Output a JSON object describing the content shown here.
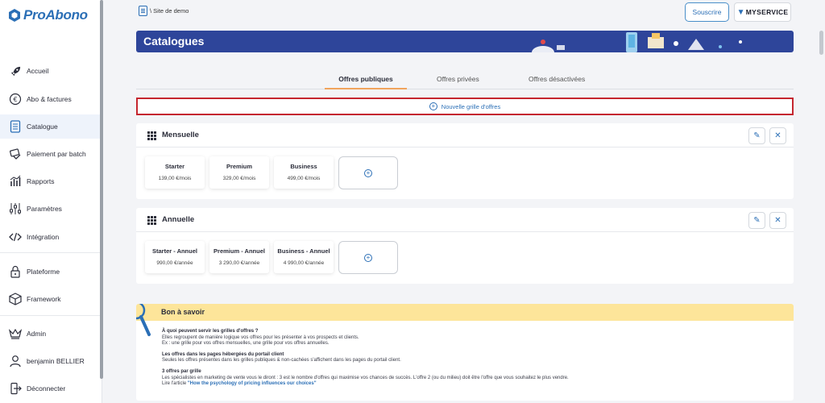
{
  "app": {
    "name": "ProAbono"
  },
  "sidebar": {
    "items": [
      {
        "label": "Accueil",
        "icon": "rocket-icon"
      },
      {
        "label": "Abo & factures",
        "icon": "euro-icon"
      },
      {
        "label": "Catalogue",
        "icon": "catalog-icon",
        "active": true
      },
      {
        "label": "Paiement par batch",
        "icon": "batch-payment-icon"
      },
      {
        "label": "Rapports",
        "icon": "reports-icon"
      },
      {
        "label": "Paramètres",
        "icon": "settings-sliders-icon"
      },
      {
        "label": "Intégration",
        "icon": "code-icon"
      },
      {
        "label": "Plateforme",
        "icon": "lock-icon"
      },
      {
        "label": "Framework",
        "icon": "cube-icon"
      },
      {
        "label": "Admin",
        "icon": "crown-icon"
      },
      {
        "label": "benjamin BELLIER",
        "icon": "user-icon"
      },
      {
        "label": "Déconnecter",
        "icon": "logout-icon"
      }
    ]
  },
  "header": {
    "breadcrumb": "\\ Site de demo",
    "subscribe_label": "Souscrire",
    "brand_badge": "MYSERVICE",
    "page_title": "Catalogues"
  },
  "tabs": [
    {
      "label": "Offres publiques",
      "active": true
    },
    {
      "label": "Offres privées",
      "active": false
    },
    {
      "label": "Offres désactivées",
      "active": false
    }
  ],
  "new_grid_label": "Nouvelle grille d'offres",
  "grids": [
    {
      "title": "Mensuelle",
      "offers": [
        {
          "name": "Starter",
          "price": "139,00 €/mois"
        },
        {
          "name": "Premium",
          "price": "329,00 €/mois"
        },
        {
          "name": "Business",
          "price": "499,00 €/mois"
        }
      ]
    },
    {
      "title": "Annuelle",
      "offers": [
        {
          "name": "Starter - Annuel",
          "price": "990,00 €/année"
        },
        {
          "name": "Premium - Annuel",
          "price": "3 290,00 €/année"
        },
        {
          "name": "Business - Annuel",
          "price": "4 990,00 €/année"
        }
      ]
    }
  ],
  "info": {
    "title": "Bon à savoir",
    "q1": "À quoi peuvent servir les grilles d'offres ?",
    "q1_l1": "Elles regroupent de manière logique vos offres pour les présenter à vos prospects et clients.",
    "q1_l2": "Ex : une grille pour vos offres mensuelles, une grille pour vos offres annuelles.",
    "q2": "Les offres dans les pages hébergées du portail client",
    "q2_l1": "Seules les offres présentes dans les grilles publiques & non-cachées s'affichent dans les pages du portail client.",
    "q3": "3 offres par grille",
    "q3_l1": "Les spécialistes en marketing de vente vous le diront : 3 est le nombre d'offres qui maximise vos chances de succès. L'offre 2 (ou du milieu) doit être l'offre que vous souhaitez le plus vendre.",
    "q3_l2_prefix": "Lire l'article ",
    "q3_link": "\"How the psychology of pricing influences our choices\""
  },
  "colors": {
    "brand": "#2b6fb6",
    "banner": "#2e459a",
    "accent": "#f0a45d",
    "highlight_border": "#c5262f",
    "info_header": "#fde59a"
  }
}
